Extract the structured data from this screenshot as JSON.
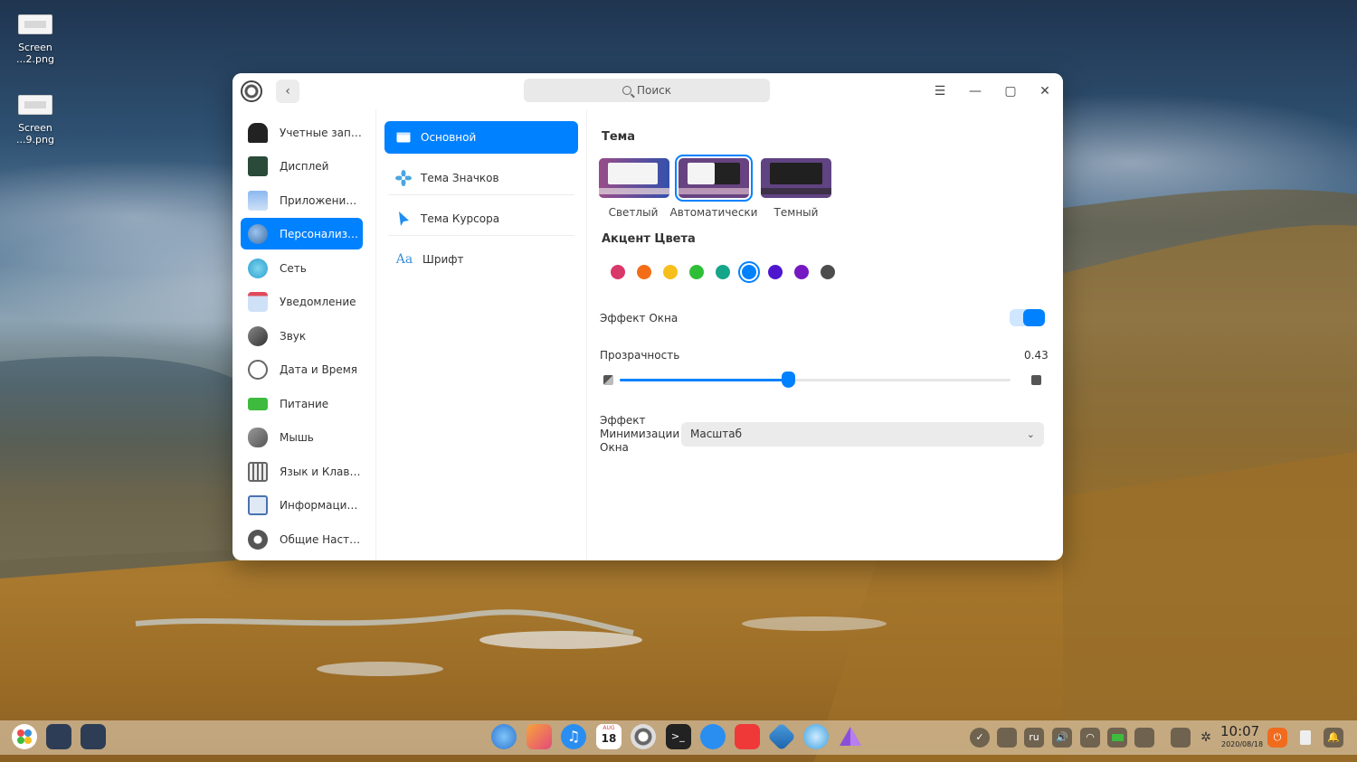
{
  "desktop": {
    "icons": [
      {
        "label_line1": "Screen",
        "label_line2": "...2.png"
      },
      {
        "label_line1": "Screen",
        "label_line2": "...9.png"
      }
    ]
  },
  "window": {
    "search_placeholder": "Поиск",
    "controls": {
      "menu": "☰",
      "minimize": "—",
      "maximize": "▢",
      "close": "✕"
    }
  },
  "sidebar": {
    "items": [
      {
        "label": "Учетные записи",
        "icon": "user-icon",
        "color": "#222222"
      },
      {
        "label": "Дисплей",
        "icon": "display-icon",
        "color": "#2a4a3a"
      },
      {
        "label": "Приложения п...",
        "icon": "apps-icon",
        "color": "#6aa2e8"
      },
      {
        "label": "Персонализац...",
        "icon": "personalization-icon",
        "color": "#4b7fb8",
        "active": true
      },
      {
        "label": "Сеть",
        "icon": "network-icon",
        "color": "#3ab0d8"
      },
      {
        "label": "Уведомление",
        "icon": "notification-icon",
        "color": "#6aa6e8"
      },
      {
        "label": "Звук",
        "icon": "sound-icon",
        "color": "#555555"
      },
      {
        "label": "Дата и Время",
        "icon": "clock-icon",
        "color": "#777777"
      },
      {
        "label": "Питание",
        "icon": "power-icon",
        "color": "#3ebb3e"
      },
      {
        "label": "Мышь",
        "icon": "mouse-icon",
        "color": "#666666"
      },
      {
        "label": "Язык и  Клавиа...",
        "icon": "keyboard-icon",
        "color": "#6f6f6f"
      },
      {
        "label": "Информация о...",
        "icon": "info-icon",
        "color": "#4a72b0"
      },
      {
        "label": "Общие Настро...",
        "icon": "settings-icon",
        "color": "#555555"
      }
    ]
  },
  "middle": {
    "items": [
      {
        "label": "Основной",
        "icon": "window-icon",
        "active": true
      },
      {
        "label": "Тема Значков",
        "icon": "icon-theme-icon"
      },
      {
        "label": "Тема Курсора",
        "icon": "cursor-icon"
      },
      {
        "label": "Шрифт",
        "icon": "font-icon",
        "glyph": "Aa"
      }
    ]
  },
  "content": {
    "theme_title": "Тема",
    "themes": [
      {
        "label": "Светлый",
        "selected": false
      },
      {
        "label": "Автоматически",
        "selected": true
      },
      {
        "label": "Темный",
        "selected": false
      }
    ],
    "accent_title": "Акцент Цвета",
    "accent_colors": [
      "#d9386b",
      "#f36d17",
      "#f6bf1b",
      "#2fbf36",
      "#15a58a",
      "#0081ff",
      "#4e17cf",
      "#7518c1",
      "#4d4d4d"
    ],
    "accent_selected_index": 5,
    "window_effect_label": "Эффект Окна",
    "window_effect_on": true,
    "transparency_label": "Прозрачность",
    "transparency_value": "0.43",
    "transparency_level": 0.43,
    "minimize_effect_label_1": "Эффект",
    "minimize_effect_label_2": "Минимизации",
    "minimize_effect_label_3": "Окна",
    "minimize_effect_value": "Масштаб"
  },
  "dock": {
    "apps": [
      "launcher-icon",
      "multitasking-icon",
      "workspace-icon",
      "file-manager-icon",
      "photos-icon",
      "music-icon",
      "calendar-icon",
      "settings-icon",
      "terminal-icon",
      "app-store-icon",
      "vivaldi-icon",
      "deepin-icon",
      "browser-icon",
      "prism-icon"
    ],
    "calendar_month": "AUG",
    "calendar_day": "18",
    "lang": "ru",
    "time": "10:07",
    "date": "2020/08/18"
  }
}
